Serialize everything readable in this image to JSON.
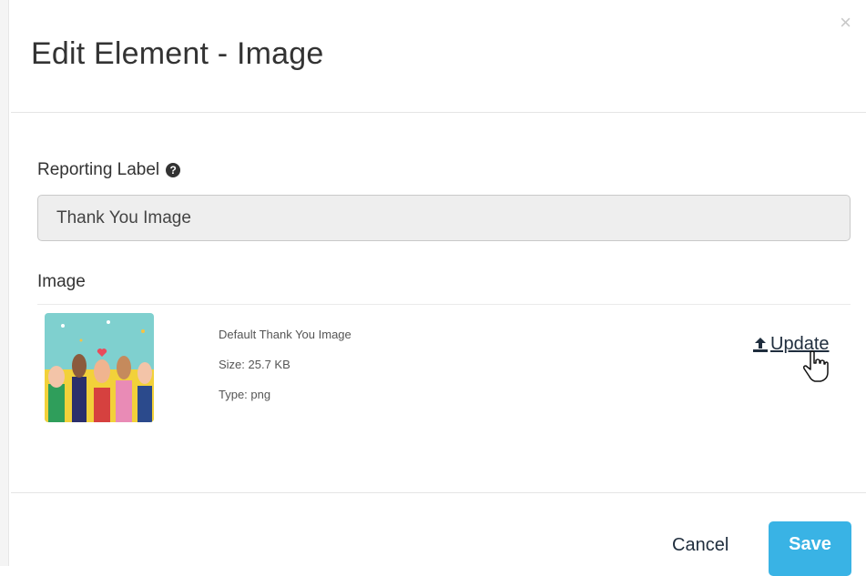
{
  "dialog": {
    "title": "Edit Element - Image",
    "close_glyph": "×"
  },
  "reporting_label": {
    "label": "Reporting Label",
    "help_icon": "question-circle-icon",
    "value": "Thank You Image"
  },
  "image": {
    "section_label": "Image",
    "name": "Default Thank You Image",
    "size": "Size: 25.7 KB",
    "type": "Type: png",
    "update_label": "Update",
    "update_icon": "upload-icon"
  },
  "footer": {
    "cancel_label": "Cancel",
    "save_label": "Save"
  },
  "colors": {
    "accent": "#39b3e5",
    "link": "#1f2d3d"
  }
}
